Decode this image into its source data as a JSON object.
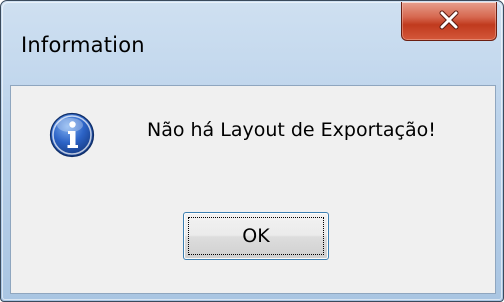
{
  "dialog": {
    "title": "Information",
    "message": "Não há Layout de Exportação!",
    "ok_label": "OK",
    "icon": "info-icon",
    "close_icon": "close-icon"
  },
  "colors": {
    "close_button": "#c8452a",
    "icon_blue": "#1f4fa8",
    "client_bg": "#f0f0f0",
    "frame": "#b9d1ea"
  }
}
